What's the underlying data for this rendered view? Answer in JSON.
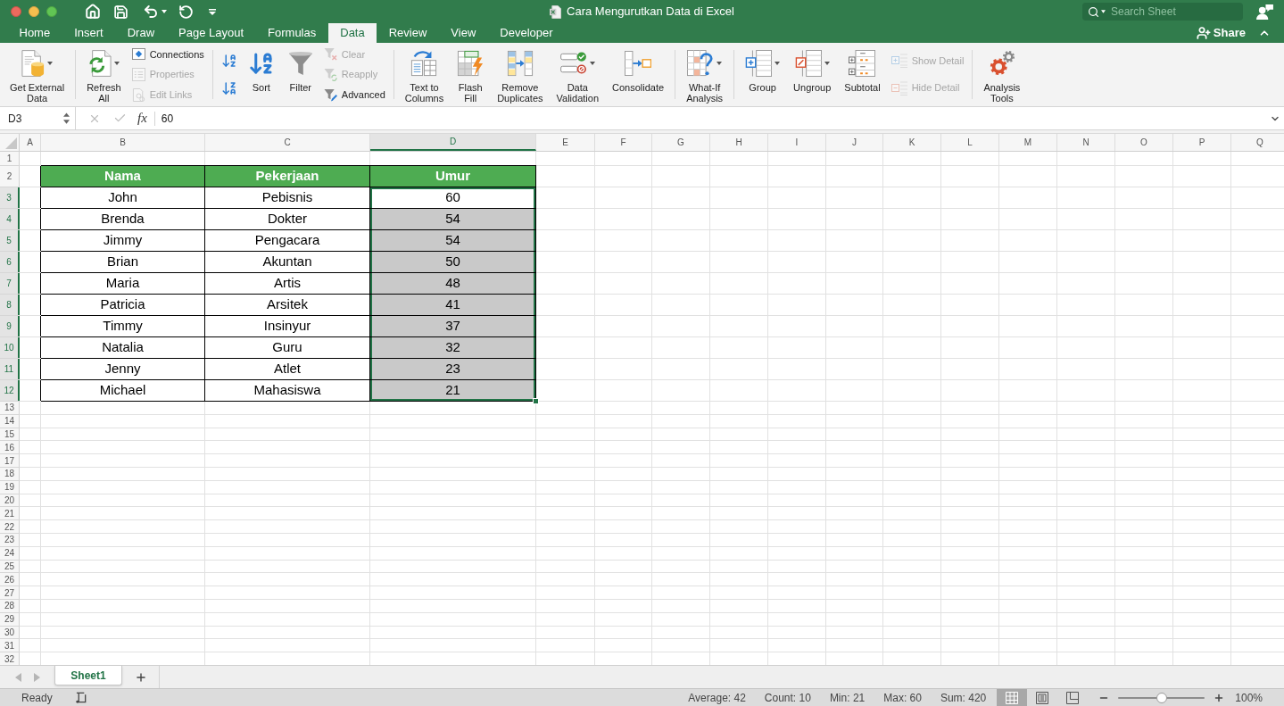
{
  "window": {
    "title": "Cara Mengurutkan Data di Excel"
  },
  "search": {
    "placeholder": "Search Sheet"
  },
  "tabs": [
    {
      "label": "Home",
      "selected": false
    },
    {
      "label": "Insert",
      "selected": false
    },
    {
      "label": "Draw",
      "selected": false
    },
    {
      "label": "Page Layout",
      "selected": false
    },
    {
      "label": "Formulas",
      "selected": false
    },
    {
      "label": "Data",
      "selected": true
    },
    {
      "label": "Review",
      "selected": false
    },
    {
      "label": "View",
      "selected": false
    },
    {
      "label": "Developer",
      "selected": false
    }
  ],
  "share_button": {
    "label": "Share"
  },
  "ribbon": {
    "groups": [
      {
        "items": [
          {
            "kind": "large",
            "label": "Get External\nData",
            "dropdown": true,
            "disabled": false
          }
        ]
      },
      {
        "items": [
          {
            "kind": "large",
            "label": "Refresh\nAll",
            "dropdown": true,
            "disabled": false
          },
          {
            "kind": "small",
            "label": "Connections",
            "disabled": false
          },
          {
            "kind": "small",
            "label": "Properties",
            "disabled": true
          },
          {
            "kind": "small",
            "label": "Edit Links",
            "disabled": true
          }
        ]
      },
      {
        "items": [
          {
            "kind": "icon",
            "disabled": false
          },
          {
            "kind": "icon",
            "disabled": false
          },
          {
            "kind": "large",
            "label": "Sort",
            "dropdown": false,
            "disabled": false
          },
          {
            "kind": "large",
            "label": "Filter",
            "dropdown": false,
            "disabled": false
          },
          {
            "kind": "small",
            "label": "Clear",
            "disabled": true
          },
          {
            "kind": "small",
            "label": "Reapply",
            "disabled": true
          },
          {
            "kind": "small",
            "label": "Advanced",
            "disabled": false
          }
        ]
      },
      {
        "items": [
          {
            "kind": "large",
            "label": "Text to\nColumns",
            "dropdown": false,
            "disabled": false
          },
          {
            "kind": "large",
            "label": "Flash\nFill",
            "dropdown": false,
            "disabled": false
          },
          {
            "kind": "large",
            "label": "Remove\nDuplicates",
            "dropdown": false,
            "disabled": false
          },
          {
            "kind": "large",
            "label": "Data\nValidation",
            "dropdown": true,
            "disabled": false
          },
          {
            "kind": "large",
            "label": "Consolidate",
            "dropdown": false,
            "disabled": false
          }
        ]
      },
      {
        "items": [
          {
            "kind": "large",
            "label": "What-If\nAnalysis",
            "dropdown": true,
            "disabled": false
          }
        ]
      },
      {
        "items": [
          {
            "kind": "large",
            "label": "Group",
            "dropdown": true,
            "disabled": false
          },
          {
            "kind": "large",
            "label": "Ungroup",
            "dropdown": true,
            "disabled": false
          },
          {
            "kind": "large",
            "label": "Subtotal",
            "dropdown": false,
            "disabled": false
          },
          {
            "kind": "small",
            "label": "Show Detail",
            "disabled": true
          },
          {
            "kind": "small",
            "label": "Hide Detail",
            "disabled": true
          }
        ]
      },
      {
        "items": [
          {
            "kind": "large",
            "label": "Analysis\nTools",
            "dropdown": false,
            "disabled": false
          }
        ]
      }
    ]
  },
  "formula_bar": {
    "name_box": "D3",
    "function_label": "fx",
    "value": "60"
  },
  "sheet": {
    "columns": [
      {
        "label": "A",
        "selected": false
      },
      {
        "label": "B",
        "selected": false
      },
      {
        "label": "C",
        "selected": false
      },
      {
        "label": "D",
        "selected": true
      },
      {
        "label": "E",
        "selected": false
      },
      {
        "label": "F",
        "selected": false
      },
      {
        "label": "G",
        "selected": false
      },
      {
        "label": "H",
        "selected": false
      },
      {
        "label": "I",
        "selected": false
      },
      {
        "label": "J",
        "selected": false
      },
      {
        "label": "K",
        "selected": false
      },
      {
        "label": "L",
        "selected": false
      },
      {
        "label": "M",
        "selected": false
      },
      {
        "label": "N",
        "selected": false
      },
      {
        "label": "O",
        "selected": false
      },
      {
        "label": "P",
        "selected": false
      },
      {
        "label": "Q",
        "selected": false
      }
    ],
    "rows": [
      {
        "label": "1",
        "selected": false
      },
      {
        "label": "2",
        "selected": false
      },
      {
        "label": "3",
        "selected": true
      },
      {
        "label": "4",
        "selected": true
      },
      {
        "label": "5",
        "selected": true
      },
      {
        "label": "6",
        "selected": true
      },
      {
        "label": "7",
        "selected": true
      },
      {
        "label": "8",
        "selected": true
      },
      {
        "label": "9",
        "selected": true
      },
      {
        "label": "10",
        "selected": true
      },
      {
        "label": "11",
        "selected": true
      },
      {
        "label": "12",
        "selected": true
      },
      {
        "label": "13",
        "selected": false
      },
      {
        "label": "14",
        "selected": false
      },
      {
        "label": "15",
        "selected": false
      },
      {
        "label": "16",
        "selected": false
      },
      {
        "label": "17",
        "selected": false
      },
      {
        "label": "18",
        "selected": false
      },
      {
        "label": "19",
        "selected": false
      },
      {
        "label": "20",
        "selected": false
      },
      {
        "label": "21",
        "selected": false
      },
      {
        "label": "22",
        "selected": false
      },
      {
        "label": "23",
        "selected": false
      },
      {
        "label": "24",
        "selected": false
      },
      {
        "label": "25",
        "selected": false
      },
      {
        "label": "26",
        "selected": false
      },
      {
        "label": "27",
        "selected": false
      },
      {
        "label": "28",
        "selected": false
      },
      {
        "label": "29",
        "selected": false
      },
      {
        "label": "30",
        "selected": false
      },
      {
        "label": "31",
        "selected": false
      },
      {
        "label": "32",
        "selected": false
      }
    ],
    "table": {
      "header": [
        "Nama",
        "Pekerjaan",
        "Umur"
      ],
      "rows": [
        {
          "cells": [
            {
              "text": "John",
              "selected": false,
              "active": false
            },
            {
              "text": "Pebisnis",
              "selected": false,
              "active": false
            },
            {
              "text": "60",
              "selected": true,
              "active": true
            }
          ]
        },
        {
          "cells": [
            {
              "text": "Brenda",
              "selected": false,
              "active": false
            },
            {
              "text": "Dokter",
              "selected": false,
              "active": false
            },
            {
              "text": "54",
              "selected": true,
              "active": false
            }
          ]
        },
        {
          "cells": [
            {
              "text": "Jimmy",
              "selected": false,
              "active": false
            },
            {
              "text": "Pengacara",
              "selected": false,
              "active": false
            },
            {
              "text": "54",
              "selected": true,
              "active": false
            }
          ]
        },
        {
          "cells": [
            {
              "text": "Brian",
              "selected": false,
              "active": false
            },
            {
              "text": "Akuntan",
              "selected": false,
              "active": false
            },
            {
              "text": "50",
              "selected": true,
              "active": false
            }
          ]
        },
        {
          "cells": [
            {
              "text": "Maria",
              "selected": false,
              "active": false
            },
            {
              "text": "Artis",
              "selected": false,
              "active": false
            },
            {
              "text": "48",
              "selected": true,
              "active": false
            }
          ]
        },
        {
          "cells": [
            {
              "text": "Patricia",
              "selected": false,
              "active": false
            },
            {
              "text": "Arsitek",
              "selected": false,
              "active": false
            },
            {
              "text": "41",
              "selected": true,
              "active": false
            }
          ]
        },
        {
          "cells": [
            {
              "text": "Timmy",
              "selected": false,
              "active": false
            },
            {
              "text": "Insinyur",
              "selected": false,
              "active": false
            },
            {
              "text": "37",
              "selected": true,
              "active": false
            }
          ]
        },
        {
          "cells": [
            {
              "text": "Natalia",
              "selected": false,
              "active": false
            },
            {
              "text": "Guru",
              "selected": false,
              "active": false
            },
            {
              "text": "32",
              "selected": true,
              "active": false
            }
          ]
        },
        {
          "cells": [
            {
              "text": "Jenny",
              "selected": false,
              "active": false
            },
            {
              "text": "Atlet",
              "selected": false,
              "active": false
            },
            {
              "text": "23",
              "selected": true,
              "active": false
            }
          ]
        },
        {
          "cells": [
            {
              "text": "Michael",
              "selected": false,
              "active": false
            },
            {
              "text": "Mahasiswa",
              "selected": false,
              "active": false
            },
            {
              "text": "21",
              "selected": true,
              "active": false
            }
          ]
        }
      ]
    }
  },
  "sheet_tabs": [
    {
      "label": "Sheet1",
      "selected": true
    }
  ],
  "status_bar": {
    "status": "Ready",
    "stats": [
      "Average: 42",
      "Count: 10",
      "Min: 21",
      "Max: 60",
      "Sum: 420"
    ],
    "views": [
      {
        "selected": true
      },
      {
        "selected": false
      },
      {
        "selected": false
      }
    ],
    "zoom": {
      "level": 0.5,
      "label": "100%"
    }
  }
}
